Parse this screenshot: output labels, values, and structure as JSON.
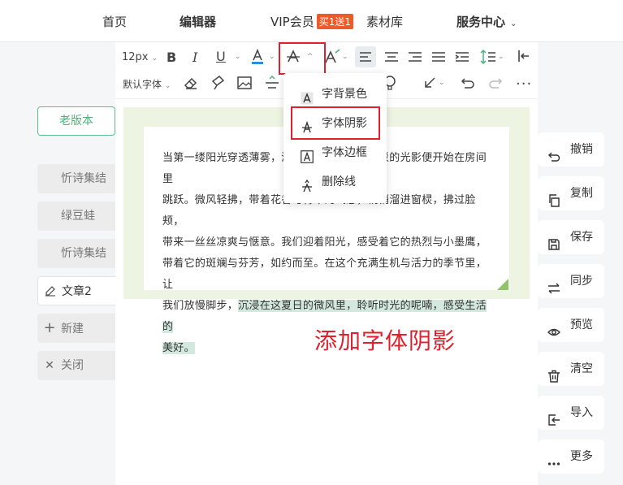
{
  "nav": {
    "home": "首页",
    "editor": "编辑器",
    "vip": "VIP会员",
    "vip_badge": "买1送1",
    "materials": "素材库",
    "service": "服务中心"
  },
  "sidebar": {
    "old_version": "老版本",
    "items": [
      {
        "label": "忻诗集结"
      },
      {
        "label": "绿豆蛙"
      },
      {
        "label": "忻诗集结"
      },
      {
        "label": "文章2"
      },
      {
        "label": "新建"
      },
      {
        "label": "关闭"
      }
    ]
  },
  "toolbar": {
    "font_size": "12px",
    "font_family": "默认字体"
  },
  "dropdown": {
    "items": [
      {
        "label": "字背景色",
        "icon": "text-background-icon"
      },
      {
        "label": "字体阴影",
        "icon": "text-shadow-icon"
      },
      {
        "label": "字体边框",
        "icon": "text-border-icon"
      },
      {
        "label": "删除线",
        "icon": "strikethrough-icon"
      }
    ]
  },
  "content": {
    "lines": [
      "当第一缕阳光穿透薄雾，清晨的鸟鸣声中，斑驳的光影便开始在房间里",
      "跳跃。微风轻拂，带着花香与青草的气息，悄悄溜进窗棂，拂过脸颊，",
      "带来一丝丝凉爽与惬意。我们迎着阳光，感受着它的热烈与小墨鹰，",
      "带着它的斑斓与芬芳，如约而至。在这个充满生机与活力的季节里，让",
      "我们放慢脚步，"
    ],
    "highlight_1": "沉浸在这夏日的微风里，聆听时光的呢喃，感受生活的",
    "highlight_2": "美好。"
  },
  "caption": "添加字体阴影",
  "actions": [
    {
      "label": "撤销",
      "icon": "undo-icon"
    },
    {
      "label": "复制",
      "icon": "copy-icon"
    },
    {
      "label": "保存",
      "icon": "save-icon"
    },
    {
      "label": "同步",
      "icon": "sync-icon"
    },
    {
      "label": "预览",
      "icon": "eye-icon"
    },
    {
      "label": "清空",
      "icon": "trash-icon"
    },
    {
      "label": "导入",
      "icon": "import-icon"
    },
    {
      "label": "更多",
      "icon": "more-icon"
    }
  ],
  "colors": {
    "accent_green": "#4fb07a",
    "highlight": "#d3e8de",
    "annotation_red": "#e0202c",
    "content_bg": "#eef4e2"
  }
}
